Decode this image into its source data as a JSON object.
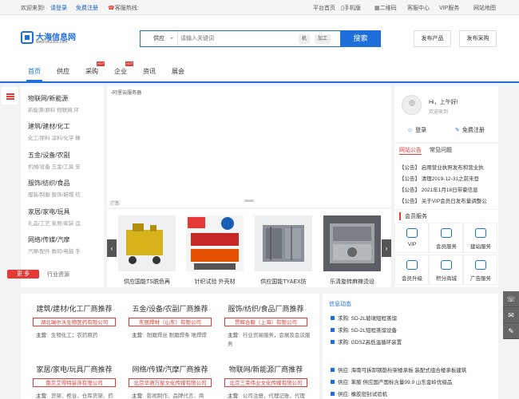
{
  "topbar": {
    "welcome": "欢迎来到!",
    "login": "请登录",
    "register": "免费注册",
    "hotline": "客服热线:",
    "links": [
      "平台首页",
      "手机版",
      "二维码",
      "客服中心",
      "VIP服务",
      "网站地图"
    ]
  },
  "logo": {
    "name": "大海信息网",
    "domain": "www.dh3366.com"
  },
  "search": {
    "category": "供应",
    "placeholder": "请输入关键词",
    "tags": [
      "机",
      "加工"
    ],
    "button": "搜索"
  },
  "header_buttons": [
    "发布产品",
    "发布采购"
  ],
  "nav": {
    "items": [
      "首页",
      "供应",
      "采购",
      "企业",
      "资讯",
      "展会"
    ],
    "hot_badge": "HOT"
  },
  "categories": [
    {
      "title": "物联网/新能源",
      "sub": "新能源/原料 物联网 环"
    },
    {
      "title": "建筑/建材/化工",
      "sub": "化工/原料 涂料/化学 橡"
    },
    {
      "title": "五金/设备/农副",
      "sub": "机械/设备 五金/工具 安"
    },
    {
      "title": "服饰/纺织/食品",
      "sub": "服装/制服 服饰/鞋帽 纺"
    },
    {
      "title": "家居/家电/玩具",
      "sub": "礼品/工艺 家居/家装 运"
    },
    {
      "title": "网络/传媒/汽摩",
      "sub": "汽摩/配件 数码/电脑 手"
    }
  ],
  "more": {
    "button": "更 多",
    "text": "行业资源"
  },
  "banner": {
    "label": "阿里云服务器",
    "ad": "广告"
  },
  "products": [
    {
      "caption": "供应国能TS脱色再"
    },
    {
      "caption": "针织试验 外壳材"
    },
    {
      "caption": "供应国能TYAEX防"
    },
    {
      "caption": "乐清旋转麻辣烫设"
    }
  ],
  "user": {
    "greeting": "Hi，上午好!",
    "welcome": "欢迎来到",
    "login": "登录",
    "register": "免费注册"
  },
  "notice": {
    "tabs": [
      "网站公告",
      "常见问题"
    ],
    "lines": [
      "【公告】 启用营业执照发布和营业执",
      "【公告】 清理2019-12-31之前未登",
      "【公告】 2021年1月18日带豪信息",
      "【公告】 关于VIP会员日发布量调整公"
    ]
  },
  "services": {
    "title": "会员服务",
    "items": [
      "VIP",
      "会员服务",
      "建站服务",
      "会员升级",
      "积分商城",
      "广告服务"
    ]
  },
  "manufacturers": [
    {
      "heading": "建筑/建材/化工厂商推荐",
      "company": "湖北瑞尔沃生物医药有限公司",
      "main_label": "主营:",
      "main": "生物化工；农药原药"
    },
    {
      "heading": "五金/设备/农副厂商推荐",
      "company": "东丽焊材（山东）有限公司",
      "main_label": "主营:",
      "main": "耐磨焊丝 耐磨焊条 堆焊焊"
    },
    {
      "heading": "服饰/纺织/食品厂商推荐",
      "company": "贯辉合服（上海）有限公司",
      "main_label": "主营:",
      "main": "行业贸易服务，会展及会议服务"
    },
    {
      "heading": "家居/家电/玩具厂商推荐",
      "company": "南京艾得特装饰有限公司",
      "main_label": "主营:",
      "main": "货架、柜台、仓库货架、药"
    },
    {
      "heading": "网络/传媒/汽摩厂商推荐",
      "company": "北京华语万星文化传媒有限公司",
      "main_label": "主营:",
      "main": "影视制作、品牌代言、商"
    },
    {
      "heading": "物联网/新能源厂商推荐",
      "company": "北京三荣伟业文化传媒有限公司",
      "main_label": "主营:",
      "main": "公司注册，代理记账，代理"
    }
  ],
  "news": {
    "heading": "信息动态",
    "lines": [
      "求购: SD-2L玻璃短程蒸馏",
      "求购: SD-2L短程蒸馏设备",
      "求购: GDSZ高低温循环装置",
      "供应: 海南可拆卸钢筋桁架楼承板 装配式组合楼承板建筑",
      "供应: 苯胺 供应国产国标含量99.9 山东金岭优级品",
      "供应: 橡胶密封试验机"
    ]
  },
  "colors": {
    "brand": "#1e6fd9",
    "accent": "#e53935"
  }
}
